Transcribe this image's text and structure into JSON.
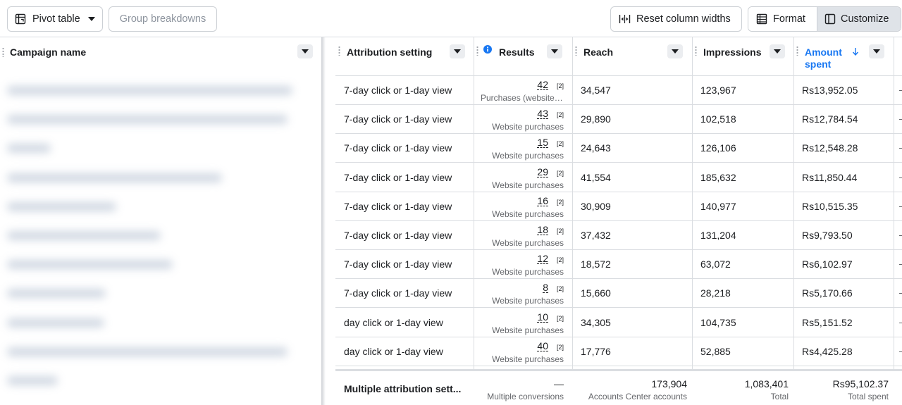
{
  "toolbar": {
    "pivot_table": "Pivot table",
    "group_breakdowns": "Group breakdowns",
    "reset_column_widths": "Reset column widths",
    "format": "Format",
    "customize": "Customize"
  },
  "columns": {
    "campaign_name": "Campaign name",
    "attribution_setting": "Attribution setting",
    "results": "Results",
    "reach": "Reach",
    "impressions": "Impressions",
    "amount_spent_line1": "Amount",
    "amount_spent_line2": "spent"
  },
  "rows": [
    {
      "attribution": "7-day click or 1-day view",
      "results": "42",
      "results_ref": "[2]",
      "results_type": "Purchases (website ...",
      "reach": "34,547",
      "impressions": "123,967",
      "amount": "Rs13,952.05"
    },
    {
      "attribution": "7-day click or 1-day view",
      "results": "43",
      "results_ref": "[2]",
      "results_type": "Website purchases",
      "reach": "29,890",
      "impressions": "102,518",
      "amount": "Rs12,784.54"
    },
    {
      "attribution": "7-day click or 1-day view",
      "results": "15",
      "results_ref": "[2]",
      "results_type": "Website purchases",
      "reach": "24,643",
      "impressions": "126,106",
      "amount": "Rs12,548.28"
    },
    {
      "attribution": "7-day click or 1-day view",
      "results": "29",
      "results_ref": "[2]",
      "results_type": "Website purchases",
      "reach": "41,554",
      "impressions": "185,632",
      "amount": "Rs11,850.44"
    },
    {
      "attribution": "7-day click or 1-day view",
      "results": "16",
      "results_ref": "[2]",
      "results_type": "Website purchases",
      "reach": "30,909",
      "impressions": "140,977",
      "amount": "Rs10,515.35"
    },
    {
      "attribution": "7-day click or 1-day view",
      "results": "18",
      "results_ref": "[2]",
      "results_type": "Website purchases",
      "reach": "37,432",
      "impressions": "131,204",
      "amount": "Rs9,793.50"
    },
    {
      "attribution": "7-day click or 1-day view",
      "results": "12",
      "results_ref": "[2]",
      "results_type": "Website purchases",
      "reach": "18,572",
      "impressions": "63,072",
      "amount": "Rs6,102.97"
    },
    {
      "attribution": "7-day click or 1-day view",
      "results": "8",
      "results_ref": "[2]",
      "results_type": "Website purchases",
      "reach": "15,660",
      "impressions": "28,218",
      "amount": "Rs5,170.66"
    },
    {
      "attribution": "day click or 1-day view",
      "results": "10",
      "results_ref": "[2]",
      "results_type": "Website purchases",
      "reach": "34,305",
      "impressions": "104,735",
      "amount": "Rs5,151.52"
    },
    {
      "attribution": "day click or 1-day view",
      "results": "40",
      "results_ref": "[2]",
      "results_type": "Website purchases",
      "reach": "17,776",
      "impressions": "52,885",
      "amount": "Rs4,425.28"
    }
  ],
  "totals": {
    "attribution": "Multiple attribution sett...",
    "results": "—",
    "results_sub": "Multiple conversions",
    "reach": "173,904",
    "reach_sub": "Accounts Center accounts",
    "impressions": "1,083,401",
    "impressions_sub": "Total",
    "amount": "Rs95,102.37",
    "amount_sub": "Total spent"
  },
  "colors": {
    "accent": "#1877f2",
    "active_segment": "#dfe3e8",
    "border": "#dadde1",
    "secondary_text": "#65676b"
  }
}
